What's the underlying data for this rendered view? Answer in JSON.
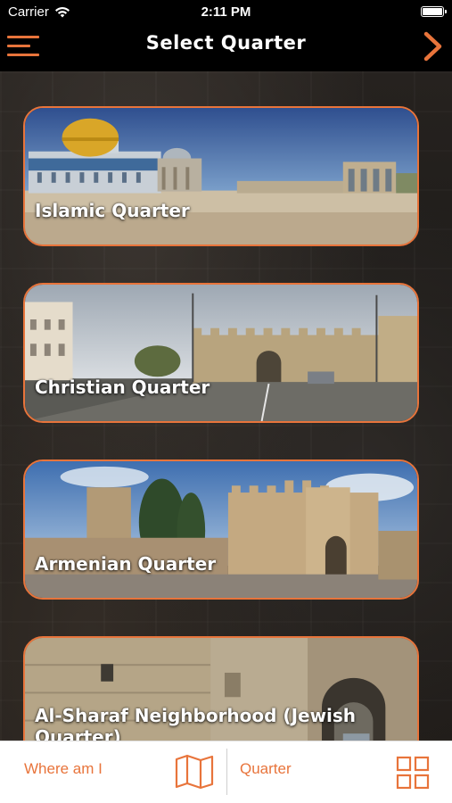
{
  "status_bar": {
    "carrier": "Carrier",
    "time": "2:11 PM"
  },
  "nav": {
    "title": "Select Quarter"
  },
  "quarters": [
    {
      "label": "Islamic Quarter"
    },
    {
      "label": "Christian Quarter"
    },
    {
      "label": "Armenian Quarter"
    },
    {
      "label": "Al-Sharaf Neighborhood (Jewish Quarter)"
    }
  ],
  "tab_bar": {
    "where_am_i": "Where am I",
    "quarter": "Quarter"
  },
  "colors": {
    "accent": "#e8743b",
    "background": "#000000",
    "tab_background": "#ffffff"
  },
  "icons": [
    "menu-icon",
    "chevron-right-icon",
    "wifi-icon",
    "battery-icon",
    "map-icon",
    "grid-icon"
  ]
}
